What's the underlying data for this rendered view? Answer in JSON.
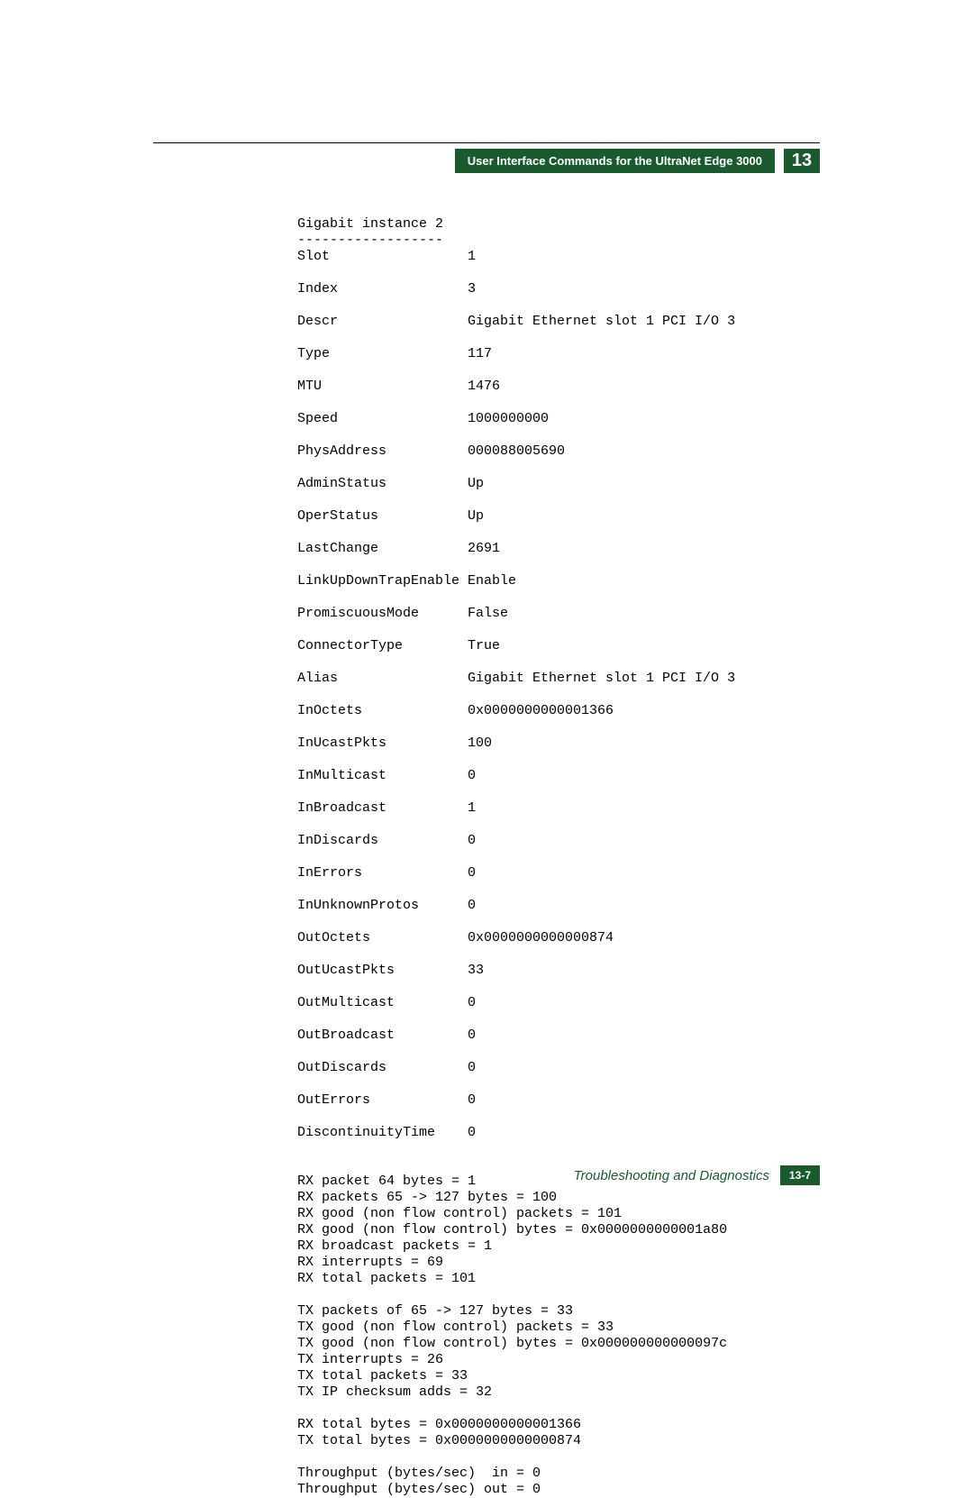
{
  "header": {
    "title": "User Interface Commands for the UltraNet Edge 3000",
    "chapter": "13"
  },
  "section": {
    "heading": "Gigabit instance 2",
    "separator": "------------------"
  },
  "fields": [
    {
      "key": "Slot",
      "value": "1"
    },
    {
      "key": "Index",
      "value": "3"
    },
    {
      "key": "Descr",
      "value": "Gigabit Ethernet slot 1 PCI I/O 3"
    },
    {
      "key": "Type",
      "value": "117"
    },
    {
      "key": "MTU",
      "value": "1476"
    },
    {
      "key": "Speed",
      "value": "1000000000"
    },
    {
      "key": "PhysAddress",
      "value": "000088005690"
    },
    {
      "key": "AdminStatus",
      "value": "Up"
    },
    {
      "key": "OperStatus",
      "value": "Up"
    },
    {
      "key": "LastChange",
      "value": "2691"
    },
    {
      "key": "LinkUpDownTrapEnable",
      "value": "Enable"
    },
    {
      "key": "PromiscuousMode",
      "value": "False"
    },
    {
      "key": "ConnectorType",
      "value": "True"
    },
    {
      "key": "Alias",
      "value": "Gigabit Ethernet slot 1 PCI I/O 3"
    },
    {
      "key": "InOctets",
      "value": "0x0000000000001366"
    },
    {
      "key": "InUcastPkts",
      "value": "100"
    },
    {
      "key": "InMulticast",
      "value": "0"
    },
    {
      "key": "InBroadcast",
      "value": "1"
    },
    {
      "key": "InDiscards",
      "value": "0"
    },
    {
      "key": "InErrors",
      "value": "0"
    },
    {
      "key": "InUnknownProtos",
      "value": "0"
    },
    {
      "key": "OutOctets",
      "value": "0x0000000000000874"
    },
    {
      "key": "OutUcastPkts",
      "value": "33"
    },
    {
      "key": "OutMulticast",
      "value": "0"
    },
    {
      "key": "OutBroadcast",
      "value": "0"
    },
    {
      "key": "OutDiscards",
      "value": "0"
    },
    {
      "key": "OutErrors",
      "value": "0"
    },
    {
      "key": "DiscontinuityTime",
      "value": "0"
    }
  ],
  "rx_lines": [
    "RX packet 64 bytes = 1",
    "RX packets 65 -> 127 bytes = 100",
    "RX good (non flow control) packets = 101",
    "RX good (non flow control) bytes = 0x0000000000001a80",
    "RX broadcast packets = 1",
    "RX interrupts = 69",
    "RX total packets = 101"
  ],
  "tx_lines": [
    "TX packets of 65 -> 127 bytes = 33",
    "TX good (non flow control) packets = 33",
    "TX good (non flow control) bytes = 0x000000000000097c",
    "TX interrupts = 26",
    "TX total packets = 33",
    "TX IP checksum adds = 32"
  ],
  "totals_lines": [
    "RX total bytes = 0x0000000000001366",
    "TX total bytes = 0x0000000000000874"
  ],
  "throughput_lines": [
    "Throughput (bytes/sec)  in = 0",
    "Throughput (bytes/sec) out = 0"
  ],
  "footer": {
    "title": "Troubleshooting and Diagnostics",
    "page": "13-7"
  }
}
